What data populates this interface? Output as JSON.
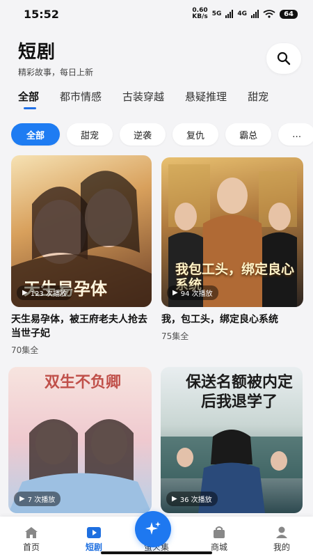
{
  "status_bar": {
    "time": "15:52",
    "net_speed_value": "0.60",
    "net_speed_unit": "KB/s",
    "network1": "5G",
    "network2": "4G",
    "battery": "64"
  },
  "header": {
    "title": "短剧",
    "subtitle": "精彩故事，每日上新",
    "search_icon": "search-icon"
  },
  "tabs": [
    "全部",
    "都市情感",
    "古装穿越",
    "悬疑推理",
    "甜宠"
  ],
  "active_tab": 0,
  "chips": [
    "全部",
    "甜宠",
    "逆袭",
    "复仇",
    "霸总",
    "…"
  ],
  "active_chip": 0,
  "dramas": [
    {
      "title": "天生易孕体，被王府老夫人抢去当世子妃",
      "plays": "123 次播放",
      "episodes": "70集全",
      "poster_text": "天生易孕体"
    },
    {
      "title": "我，包工头，绑定良心系统",
      "plays": "94 次播放",
      "episodes": "75集全",
      "poster_text": "我包工头，绑定良心系统"
    },
    {
      "title": "",
      "plays": "7 次播放",
      "episodes": "",
      "poster_text": "双生不负卿"
    },
    {
      "title": "",
      "plays": "36 次播放",
      "episodes": "",
      "poster_text": "保送名额被内定后我退学了"
    }
  ],
  "bottom_nav": {
    "items": [
      {
        "label": "首页",
        "icon": "home-icon"
      },
      {
        "label": "短剧",
        "icon": "play-icon"
      },
      {
        "label": "萤火集",
        "icon": "sparkle-icon"
      },
      {
        "label": "商城",
        "icon": "shop-icon"
      },
      {
        "label": "我的",
        "icon": "user-icon"
      }
    ],
    "active": 1
  },
  "colors": {
    "accent": "#1e7cf2",
    "background": "#f4f4f6"
  }
}
